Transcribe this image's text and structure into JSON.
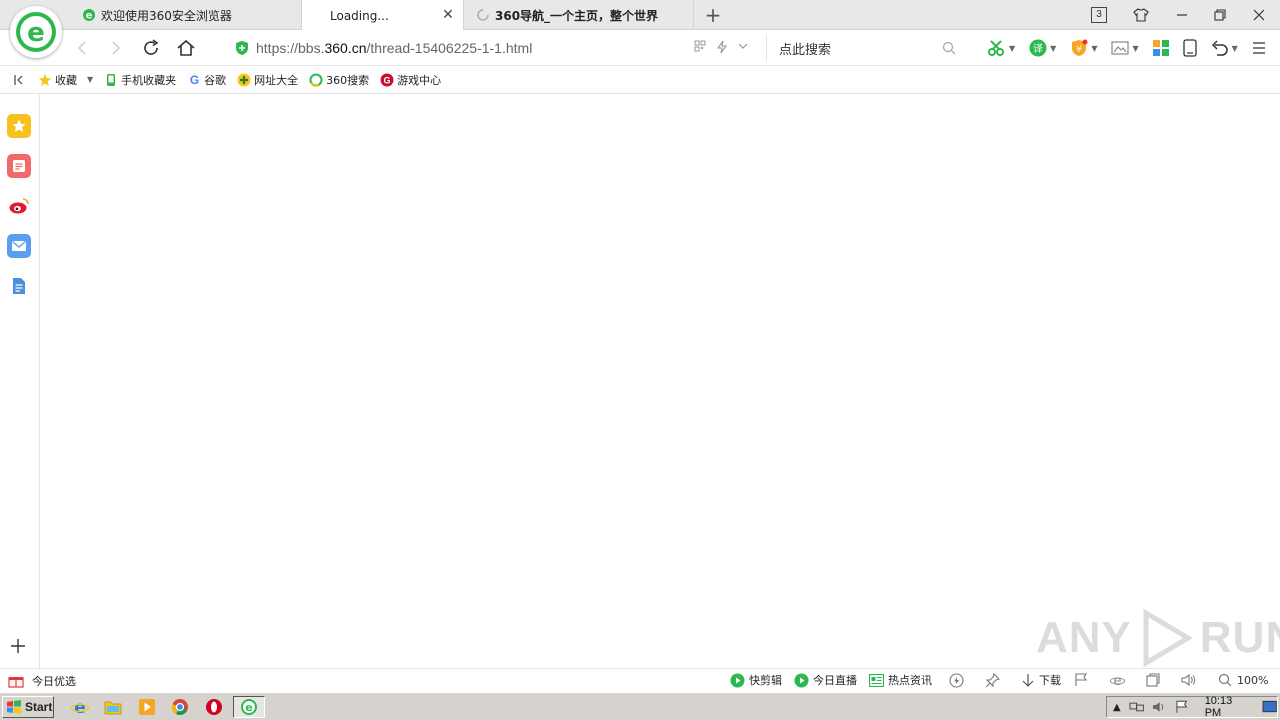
{
  "tabs": [
    {
      "title": "欢迎使用360安全浏览器",
      "active": false,
      "icon": "ie-green-icon"
    },
    {
      "title": "Loading...",
      "active": true,
      "icon": "none"
    },
    {
      "title": "360导航_一个主页，整个世界",
      "active": false,
      "icon": "loading-spinner-icon"
    }
  ],
  "window": {
    "tab_count": "3"
  },
  "address_bar": {
    "url_prefix": "https://bbs.",
    "url_domain": "360.cn",
    "url_path": "/thread-15406225-1-1.html"
  },
  "search": {
    "placeholder": "点此搜索"
  },
  "bookmarks": [
    {
      "label": "收藏",
      "icon": "star-icon"
    },
    {
      "label": "手机收藏夹",
      "icon": "phone-icon"
    },
    {
      "label": "谷歌",
      "icon": "google-icon"
    },
    {
      "label": "网址大全",
      "icon": "web-directory-icon"
    },
    {
      "label": "360搜索",
      "icon": "360-search-icon"
    },
    {
      "label": "游戏中心",
      "icon": "game-center-icon"
    }
  ],
  "statusbar": {
    "left_label": "今日优选",
    "items": [
      {
        "label": "快剪辑",
        "icon": "play-green-icon"
      },
      {
        "label": "今日直播",
        "icon": "play-green-icon"
      },
      {
        "label": "热点资讯",
        "icon": "news-icon"
      }
    ],
    "download_label": "下载",
    "zoom": "100%"
  },
  "taskbar": {
    "start_label": "Start",
    "clock": "10:13 PM"
  },
  "watermark": {
    "text_left": "ANY",
    "text_right": "RUN"
  },
  "colors": {
    "accent_green": "#2db84d",
    "tab_bg": "#e8e8e8",
    "taskbar_bg": "#d6d3ce"
  }
}
